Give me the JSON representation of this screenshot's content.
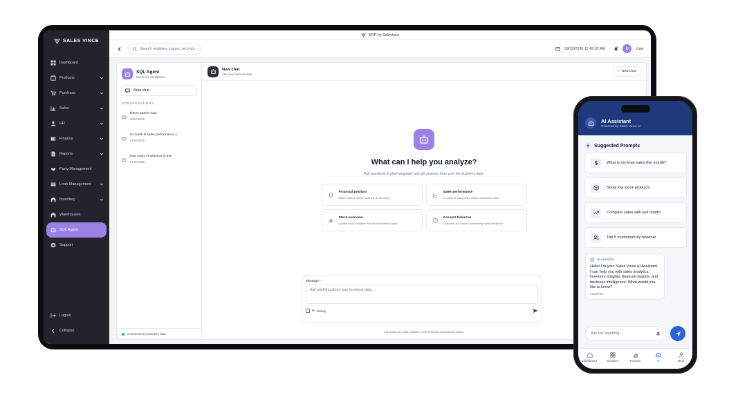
{
  "laptop": {
    "window_title": "ERP by Salevince",
    "logo_text": "SALES VINCE",
    "sidebar": {
      "items": [
        {
          "label": "Dashboard",
          "icon": "grid-icon",
          "has_chevron": false
        },
        {
          "label": "Products",
          "icon": "box-icon",
          "has_chevron": true
        },
        {
          "label": "Purchase",
          "icon": "cart-icon",
          "has_chevron": true
        },
        {
          "label": "Sales",
          "icon": "chart-icon",
          "has_chevron": true
        },
        {
          "label": "HR",
          "icon": "person-icon",
          "has_chevron": true
        },
        {
          "label": "Finance",
          "icon": "wallet-icon",
          "has_chevron": true
        },
        {
          "label": "Reports",
          "icon": "report-icon",
          "has_chevron": true
        },
        {
          "label": "Party Management",
          "icon": "handshake-icon",
          "has_chevron": false
        },
        {
          "label": "Loan Management",
          "icon": "loan-icon",
          "has_chevron": true
        },
        {
          "label": "Inventory",
          "icon": "warehouse-icon",
          "has_chevron": true
        },
        {
          "label": "Warehouses",
          "icon": "warehouse-icon",
          "has_chevron": false
        },
        {
          "label": "SQL Agent",
          "icon": "bot-icon",
          "has_chevron": false,
          "active": true
        },
        {
          "label": "Support",
          "icon": "support-icon",
          "has_chevron": false
        }
      ],
      "logout_label": "Logout",
      "collapse_label": "Collapse"
    },
    "topbar": {
      "search_placeholder": "Search modules, pages, records...",
      "datetime": "09/10/2026  11:45:02 AM",
      "avatar_initial": "U",
      "user_label": "User"
    },
    "agent_panel": {
      "title": "SQL Agent",
      "subtitle": "Business intelligence",
      "new_chat_label": "New chat",
      "conversations_label": "CONVERSATIONS",
      "conversations": [
        {
          "title": "kitnee parties hain",
          "date": "09/10/2026"
        },
        {
          "title": "Is month ki sales performance s...",
          "date": "07/07/2026"
        },
        {
          "title": "how many employees in this",
          "date": "07/07/2026"
        }
      ],
      "connection_status": "Connected to business data"
    },
    "chat": {
      "header_title": "New chat",
      "header_subtitle": "Ask your business data",
      "new_chat_button": "New chat",
      "hero_title": "What can I help you analyze?",
      "hero_subtitle": "Ask questions in plain language and get answers from your live business data.",
      "cards": [
        {
          "title": "Financial position",
          "desc": "Mujhe balance sheet bana kar do abi tak ki",
          "icon": "document-icon"
        },
        {
          "title": "Sales performance",
          "desc": "Is month ki sales performance summarize karo",
          "icon": "trend-icon"
        },
        {
          "title": "Stock overview",
          "desc": "Current stock valuation aur low stock items batao",
          "icon": "cubes-icon"
        },
        {
          "title": "Account balances",
          "desc": "Customer aur vendor outstanding balances dikhao",
          "icon": "database-icon"
        }
      ],
      "message_label": "Message *",
      "message_placeholder": "Ask anything about your business data...",
      "debug_label": "Debug",
      "disclaimer": "SQL Agent can make mistakes. Verify important financial information."
    }
  },
  "phone": {
    "header_title": "AI Assistant",
    "header_subtitle": "Powered by Sales Vince AI",
    "suggested_title": "Suggested Prompts",
    "prompts": [
      {
        "label": "What is my total sales this month?",
        "icon": "dollar-icon"
      },
      {
        "label": "Show low stock products",
        "icon": "package-icon"
      },
      {
        "label": "Compare sales with last month",
        "icon": "trend-up-icon"
      },
      {
        "label": "Top 5 customers by revenue",
        "icon": "users-icon"
      }
    ],
    "bubble_sender": "AI Assistant",
    "bubble_text": "Hello! I'm your Sales Vince AI Assistant. I can help you with sales analytics, inventory insights, financial reports, and business intelligence. What would you like to know?",
    "bubble_time": "12:28 PM",
    "input_placeholder": "Ask me anything...",
    "tabs": [
      {
        "label": "Dashboard",
        "icon": "home-icon"
      },
      {
        "label": "Modules",
        "icon": "modules-icon"
      },
      {
        "label": "Reports",
        "icon": "bar-chart-icon"
      },
      {
        "label": "AI",
        "icon": "bot-icon",
        "active": true
      },
      {
        "label": "More",
        "icon": "person-icon"
      }
    ]
  },
  "colors": {
    "accent_purple": "#9b83e6",
    "sidebar_bg": "#22232b",
    "phone_header_bg": "#1e3a7b",
    "phone_send": "#2f63d8"
  }
}
